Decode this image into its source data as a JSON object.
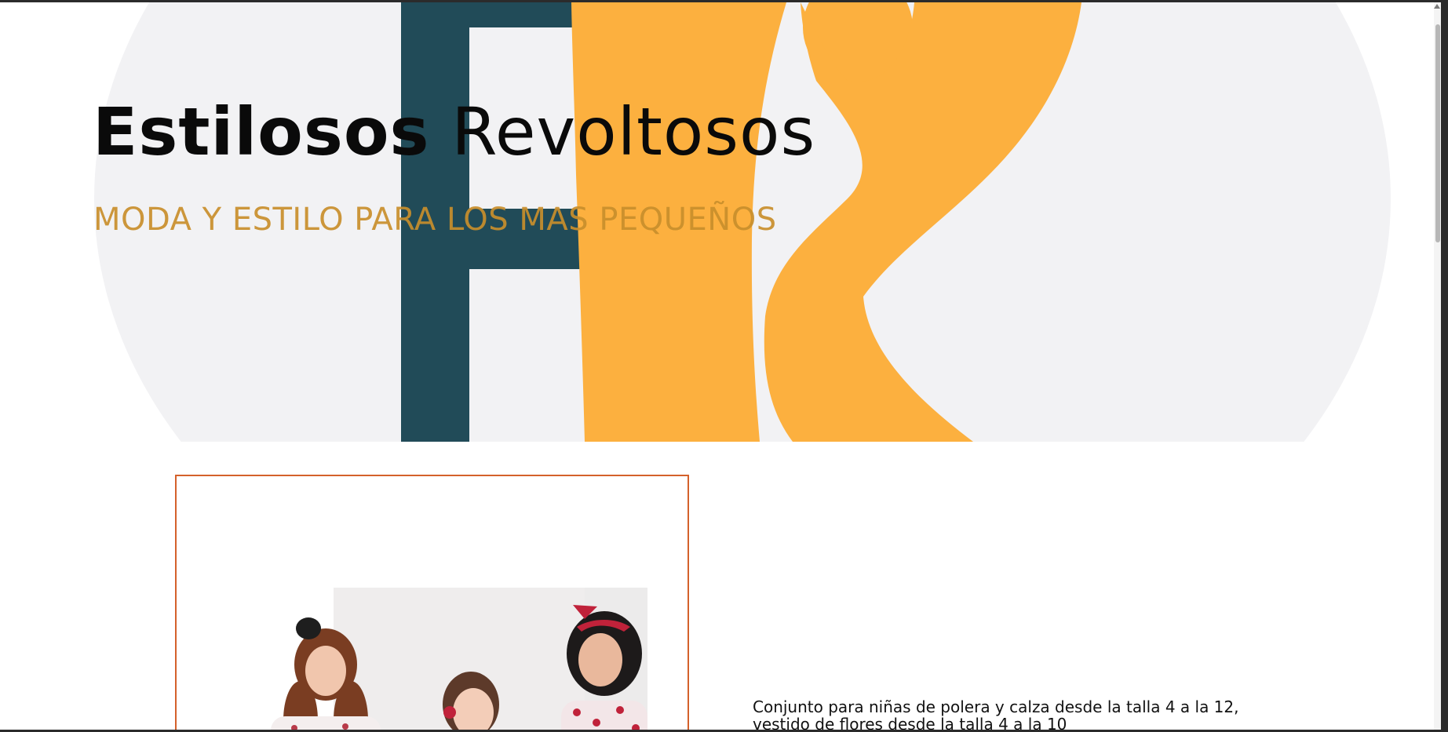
{
  "header": {
    "title_part1": "Estilosos",
    "title_part2": "Revoltosos",
    "tagline": "MODA Y ESTILO PARA LOS MAS PEQUEÑOS"
  },
  "logo": {
    "icon": "fr-monogram-logo",
    "colors": {
      "circle": "#f2f2f4",
      "letter_f": "#214b58",
      "letter_r": "#fcb03f"
    }
  },
  "product": {
    "image_icon": "three-girls-photo",
    "description": "Conjunto para niñas de polera y calza desde la talla 4 a la 12, vestido de flores desde la talla 4 a la 10",
    "border_color": "#d4612b"
  },
  "colors": {
    "tagline": "#c98f2c",
    "window_frame": "#2b2b2b"
  }
}
